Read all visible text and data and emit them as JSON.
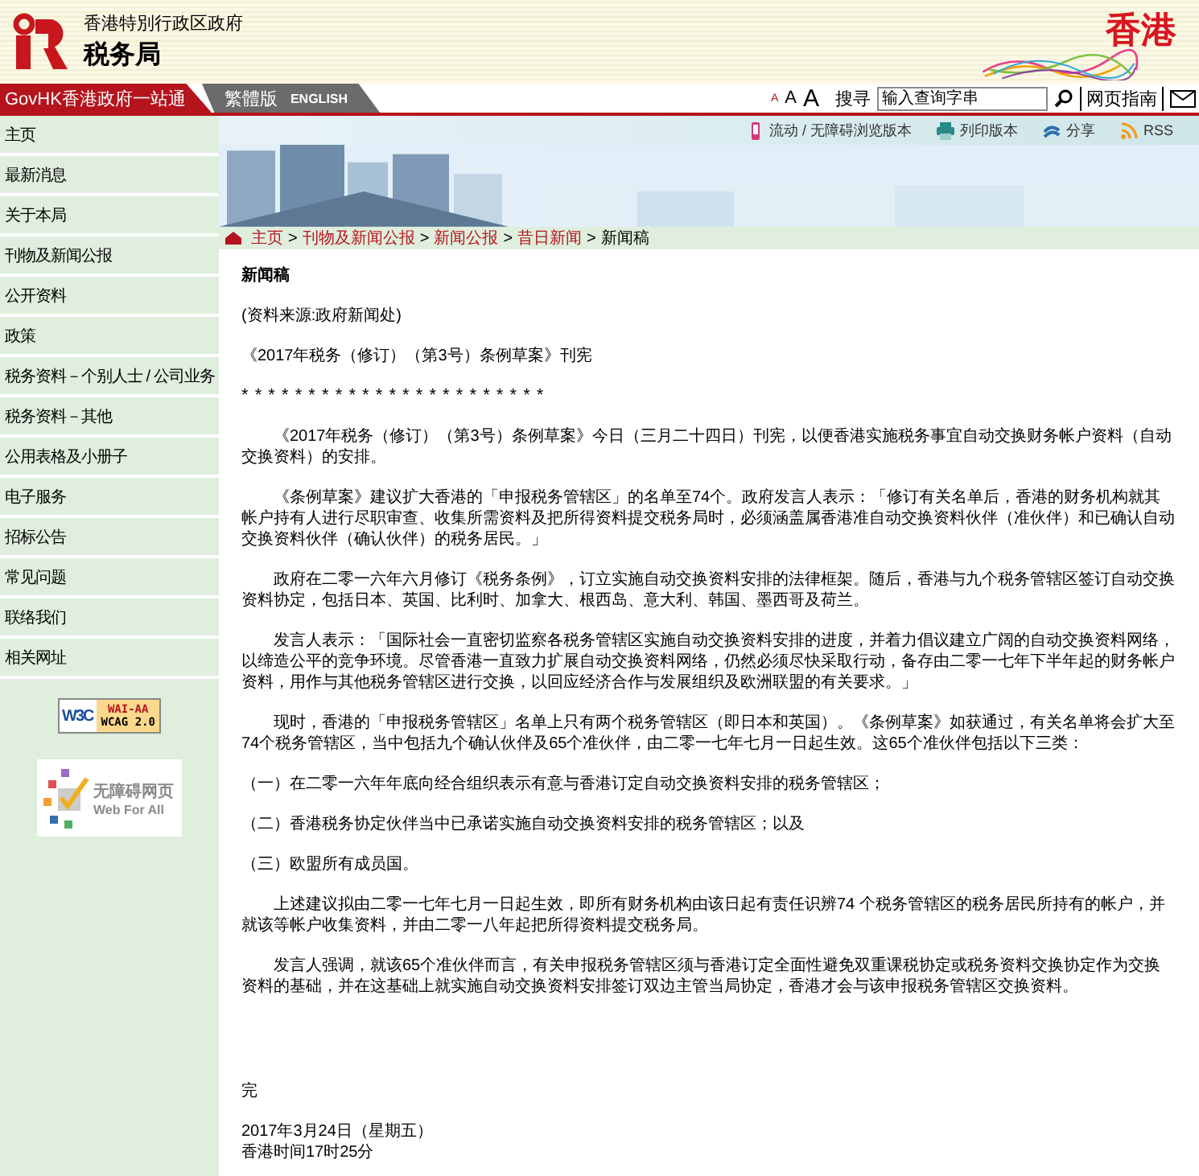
{
  "header": {
    "org_sub": "香港特別行政区政府",
    "org_name": "税务局",
    "brand": "香港"
  },
  "nav": {
    "govhk": "GovHK香港政府一站通",
    "trad": "繁體版",
    "english": "ENGLISH",
    "font_sizes": [
      "A",
      "A",
      "A"
    ],
    "search_label": "搜寻",
    "search_placeholder": "输入查询字串",
    "guide": "网页指南"
  },
  "sidebar": {
    "items": [
      {
        "label": "主页"
      },
      {
        "label": "最新消息"
      },
      {
        "label": "关于本局"
      },
      {
        "label": "刊物及新闻公报"
      },
      {
        "label": "公开资料"
      },
      {
        "label": "政策"
      },
      {
        "label": "税务资料－个别人士 / 公司业务"
      },
      {
        "label": "税务资料－其他"
      },
      {
        "label": "公用表格及小册子"
      },
      {
        "label": "电子服务"
      },
      {
        "label": "招标公告"
      },
      {
        "label": "常见问题"
      },
      {
        "label": "联络我们"
      },
      {
        "label": "相关网址"
      }
    ],
    "w3c_badge": {
      "logo": "W3C",
      "level": "WAI-AA",
      "standard": "WCAG 2.0"
    },
    "web_for_all": {
      "title": "无障碍网页",
      "subtitle": "Web For All"
    }
  },
  "tools": [
    {
      "kind": "mobile",
      "label": "流动 / 无障碍浏览版本"
    },
    {
      "kind": "print",
      "label": "列印版本"
    },
    {
      "kind": "share",
      "label": "分享"
    },
    {
      "kind": "rss",
      "label": "RSS"
    }
  ],
  "breadcrumb": {
    "separator": ">",
    "items": [
      {
        "label": "主页",
        "link": true
      },
      {
        "label": "刊物及新闻公报",
        "link": true
      },
      {
        "label": "新闻公报",
        "link": true
      },
      {
        "label": "昔日新闻",
        "link": true
      },
      {
        "label": "新闻稿",
        "link": false
      }
    ]
  },
  "article": {
    "heading": "新闻稿",
    "source": "(资料来源:政府新闻处)",
    "title": "《2017年税务（修订）（第3号）条例草案》刊宪",
    "stars": "* * * * * * * * * * * * * * * * * * * * * * *",
    "paragraphs": [
      {
        "kind": "indent",
        "text": "《2017年税务（修订）（第3号）条例草案》今日（三月二十四日）刊宪，以便香港实施税务事宜自动交换财务帐户资料（自动交换资料）的安排。"
      },
      {
        "kind": "indent",
        "text": "《条例草案》建议扩大香港的「申报税务管辖区」的名单至74个。政府发言人表示：「修订有关名单后，香港的财务机构就其帐户持有人进行尽职审查、收集所需资料及把所得资料提交税务局时，必须涵盖属香港准自动交换资料伙伴（准伙伴）和已确认自动交换资料伙伴（确认伙伴）的税务居民。」"
      },
      {
        "kind": "indent",
        "text": "政府在二零一六年六月修订《税务条例》，订立实施自动交换资料安排的法律框架。随后，香港与九个税务管辖区签订自动交换资料协定，包括日本、英国、比利时、加拿大、根西岛、意大利、韩国、墨西哥及荷兰。"
      },
      {
        "kind": "indent",
        "text": "发言人表示：「国际社会一直密切监察各税务管辖区实施自动交换资料安排的进度，并着力倡议建立广阔的自动交换资料网络，以缔造公平的竞争环境。尽管香港一直致力扩展自动交换资料网络，仍然必须尽快采取行动，备存由二零一七年下半年起的财务帐户资料，用作与其他税务管辖区进行交换，以回应经济合作与发展组织及欧洲联盟的有关要求。」"
      },
      {
        "kind": "indent",
        "text": "现时，香港的「申报税务管辖区」名单上只有两个税务管辖区（即日本和英国）。《条例草案》如获通过，有关名单将会扩大至74个税务管辖区，当中包括九个确认伙伴及65个准伙伴，由二零一七年七月一日起生效。这65个准伙伴包括以下三类："
      },
      {
        "kind": "list",
        "text": "（一）在二零一六年年底向经合组织表示有意与香港订定自动交换资料安排的税务管辖区；"
      },
      {
        "kind": "list",
        "text": "（二）香港税务协定伙伴当中已承诺实施自动交换资料安排的税务管辖区；以及"
      },
      {
        "kind": "list",
        "text": "（三）欧盟所有成员国。"
      },
      {
        "kind": "indent",
        "text": "上述建议拟由二零一七年七月一日起生效，即所有财务机构由该日起有责任识辨74 个税务管辖区的税务居民所持有的帐户，并就该等帐户收集资料，并由二零一八年起把所得资料提交税务局。"
      },
      {
        "kind": "indent",
        "text": "发言人强调，就该65个准伙伴而言，有关申报税务管辖区须与香港订定全面性避免双重课税协定或税务资料交换协定作为交换资料的基础，并在这基础上就实施自动交换资料安排签订双边主管当局协定，香港才会与该申报税务管辖区交换资料。"
      }
    ],
    "end": "完",
    "date": "2017年3月24日（星期五）",
    "time": "香港时间17时25分"
  }
}
